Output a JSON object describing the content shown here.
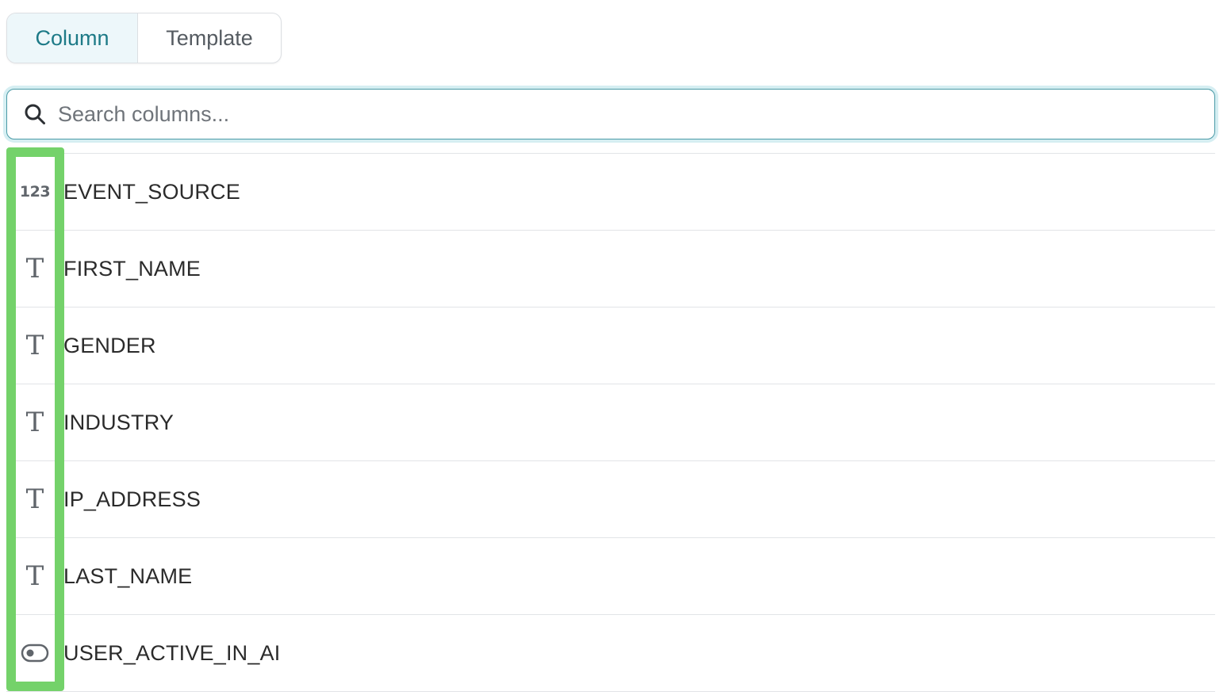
{
  "tabs": [
    {
      "label": "Column",
      "active": true
    },
    {
      "label": "Template",
      "active": false
    }
  ],
  "search": {
    "placeholder": "Search columns...",
    "value": ""
  },
  "columns": [
    {
      "type_icon": "number-type-icon",
      "type_glyph": "123",
      "name": "EVENT_SOURCE"
    },
    {
      "type_icon": "text-type-icon",
      "type_glyph": "T",
      "name": "FIRST_NAME"
    },
    {
      "type_icon": "text-type-icon",
      "type_glyph": "T",
      "name": "GENDER"
    },
    {
      "type_icon": "text-type-icon",
      "type_glyph": "T",
      "name": "INDUSTRY"
    },
    {
      "type_icon": "text-type-icon",
      "type_glyph": "T",
      "name": "IP_ADDRESS"
    },
    {
      "type_icon": "text-type-icon",
      "type_glyph": "T",
      "name": "LAST_NAME"
    },
    {
      "type_icon": "boolean-type-icon",
      "type_glyph": "",
      "name": "USER_ACTIVE_IN_AI"
    }
  ],
  "colors": {
    "accent": "#1d7a87",
    "active_tab_bg": "#edf7fa",
    "highlight": "#74d26a"
  }
}
